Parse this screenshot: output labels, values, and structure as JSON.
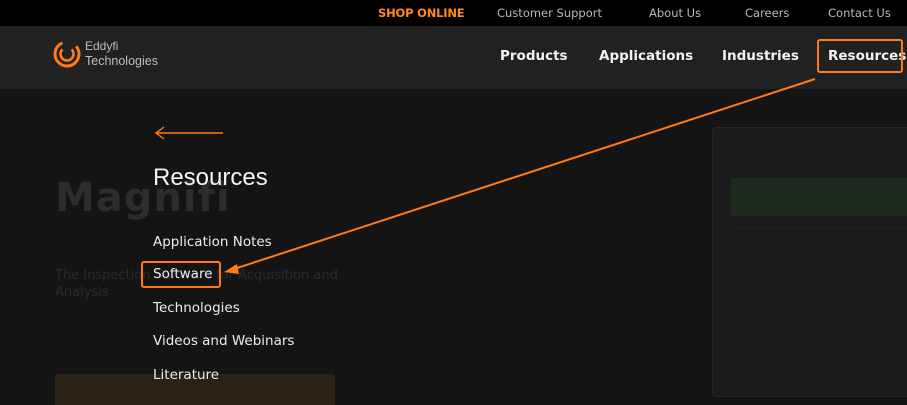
{
  "topbar": {
    "shop_online": "SHOP ONLINE",
    "customer_support": "Customer Support",
    "about_us": "About Us",
    "careers": "Careers",
    "contact_us": "Contact Us"
  },
  "logo": {
    "line1": "Eddyfi",
    "line2": "Technologies"
  },
  "nav": {
    "products": "Products",
    "applications": "Applications",
    "industries": "Industries",
    "resources": "Resources"
  },
  "hero": {
    "title": "Magnifi",
    "text": "The Inspection Software for Acquisition and Analysis"
  },
  "resources_menu": {
    "title": "Resources",
    "items": [
      "Application Notes",
      "Software",
      "Technologies",
      "Videos and Webinars",
      "Literature"
    ]
  },
  "colors": {
    "accent": "#ff7a1a",
    "shop": "#ff8a1f",
    "nav_bg": "#212121",
    "topbar_bg": "#000000"
  },
  "icons": {
    "back": "left-arrow-icon",
    "logo": "eddyfi-logo-icon"
  }
}
